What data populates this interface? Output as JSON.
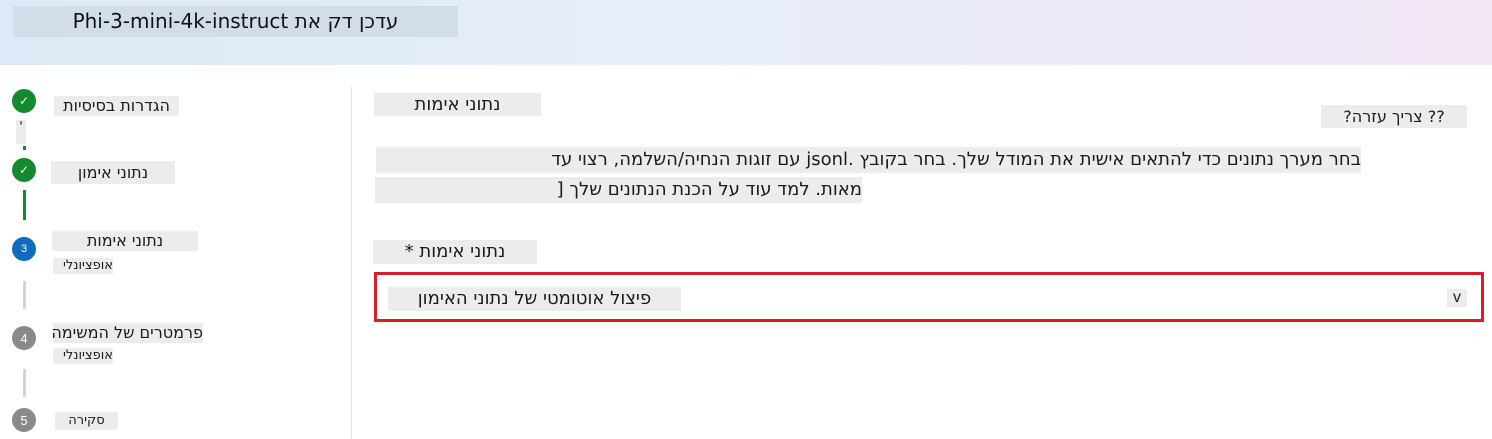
{
  "header": {
    "title": "עדכן דק את Phi-3-mini-4k-instruct"
  },
  "steps": [
    {
      "number": "✓",
      "status": "completed",
      "title": "הגדרות בסיסיות",
      "extra": "'"
    },
    {
      "number": "✓",
      "status": "completed",
      "title": "נתוני אימון"
    },
    {
      "number": "3",
      "status": "current",
      "title": "נתוני אימות",
      "subtitle": "אופציונלי"
    },
    {
      "number": "4",
      "status": "pending",
      "title": "פרמטרים של המשימה",
      "subtitle": "אופציונלי"
    },
    {
      "number": "5",
      "status": "pending",
      "title": "סקירה"
    }
  ],
  "main": {
    "section_title": "נתוני אימות",
    "help_link": "?? צריך עזרה?",
    "description_line1": "בחר מערך נתונים כדי להתאים אישית את המודל שלך. בחר בקובץ .jsonl עם זוגות הנחיה/השלמה, רצוי עד",
    "description_line2": "מאות. למד עוד על הכנת הנתונים שלך [",
    "field_label": "נתוני אימות *",
    "dropdown_value": "פיצול אוטומטי של נתוני האימון",
    "dropdown_chevron": "v"
  },
  "colors": {
    "completed": "#138a2e",
    "current": "#0f6cbd",
    "pending": "#8a8a8a",
    "highlight_border": "#d91e2a"
  }
}
